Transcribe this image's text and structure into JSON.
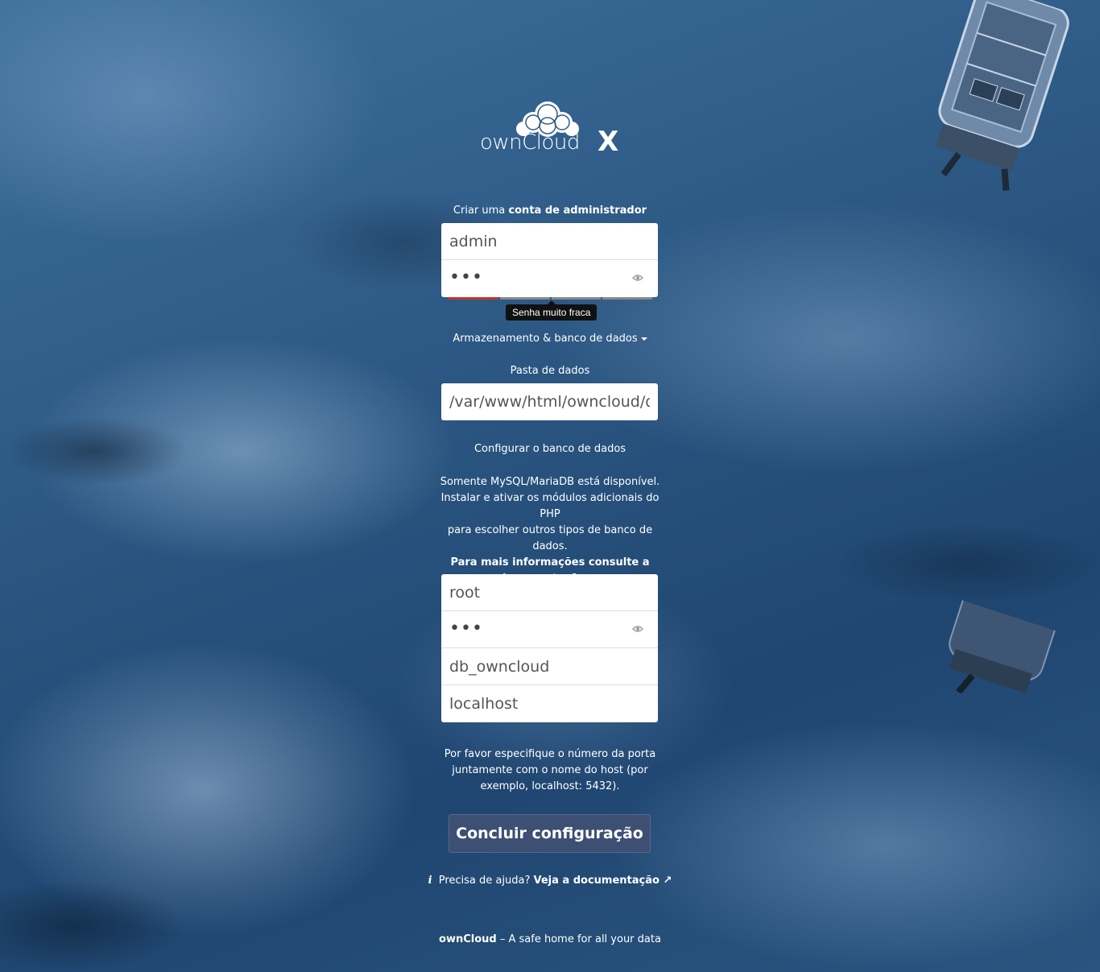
{
  "brand": {
    "name": "ownCloud",
    "version_mark": "X"
  },
  "admin": {
    "heading_prefix": "Criar uma",
    "heading_bold": "conta de administrador",
    "username_value": "admin",
    "password_dots": "•••",
    "strength_tooltip": "Senha muito fraca"
  },
  "storage": {
    "toggle_label": "Armazenamento & banco de dados",
    "data_folder_label": "Pasta de dados",
    "data_folder_value": "/var/www/html/owncloud/data"
  },
  "database": {
    "configure_label": "Configurar o banco de dados",
    "info_line1": "Somente MySQL/MariaDB está disponível.",
    "info_line2": "Instalar e ativar os módulos adicionais do PHP",
    "info_line3": "para escolher outros tipos de banco de dados.",
    "docs_link_line1": "Para mais informações consulte a",
    "docs_link_line2": "documentação. ↗",
    "user_value": "root",
    "password_dots": "•••",
    "name_value": "db_owncloud",
    "host_value": "localhost",
    "host_hint_line1": "Por favor especifique o número da porta",
    "host_hint_line2": "juntamente com o nome do host (por",
    "host_hint_line3": "exemplo, localhost: 5432)."
  },
  "submit_label": "Concluir configuração",
  "help": {
    "icon": "i",
    "text": "Precisa de ajuda?",
    "link": "Veja a documentação ↗"
  },
  "footer": {
    "brand": "ownCloud",
    "tagline": "– A safe home for all your data"
  },
  "colors": {
    "button_bg": "#3d4f73",
    "strength_weak": "#c0392b"
  }
}
